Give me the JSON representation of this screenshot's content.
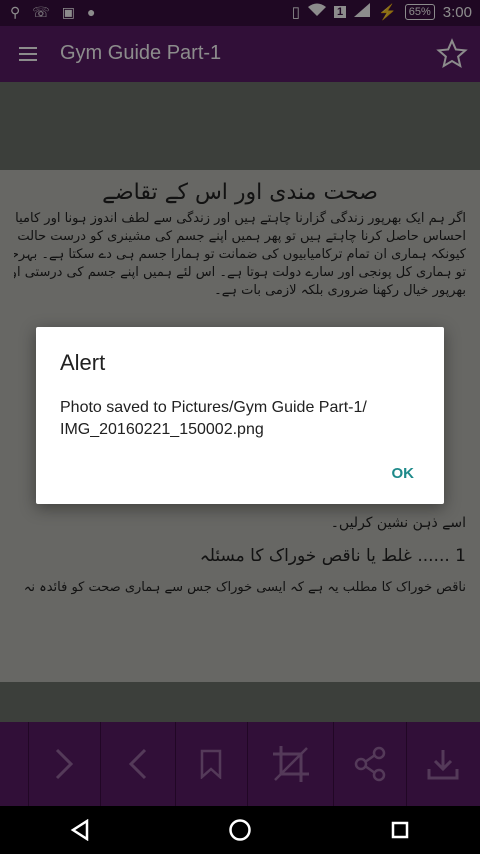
{
  "status_bar": {
    "battery": "65%",
    "time": "3:00",
    "sim": "1"
  },
  "toolbar": {
    "title": "Gym Guide Part-1",
    "menu_icon": "menu-icon",
    "star_icon": "star-outline-icon"
  },
  "page": {
    "heading": "صحت مندی اور اس کے تقاضے",
    "paragraph": [
      "اگر ہم ایک بھرپور زندگی گزارنا چاہتے ہیں اور زندگی سے لطف اندوز ہونا اور کامیابی کا",
      "احساس حاصل کرنا چاہتے ہیں تو پھر ہمیں اپنے جسم کی مشینری کو درست حالت میں رکھنا ہوگا۔",
      "کیونکہ ہماری ان تمام ترکامیابیوں کی ضمانت تو ہمارا جسم ہی دے سکتا ہے۔ بہرحال یہی",
      "تو ہماری کل پونجی اور سارے دولت ہوتا ہے۔ اس لئے ہمیں اپنے جسم کی درستی اور مرمت کا",
      "بھرپور خیال رکھنا ضروری بلکہ لازمی بات ہے۔"
    ],
    "line2": "اسے ذہن نشین کرلیں۔",
    "heading2": "1 ...... غلط یا ناقص خوراک کا مسئلہ",
    "line3": "ناقص خوراک کا مطلب یہ ہے کہ ایسی خوراک جس سے ہماری صحت کو فائدہ نہ"
  },
  "dialog": {
    "title": "Alert",
    "message": "Photo saved to Pictures/Gym Guide Part-1/ IMG_20160221_150002.png",
    "ok": "OK"
  },
  "bottom_bar": [
    "next-arrow-icon",
    "previous-arrow-icon",
    "bookmark-icon",
    "crop-icon",
    "share-icon",
    "download-icon"
  ],
  "colors": {
    "primary": "#5a1c66",
    "status_bar": "#3a0f40",
    "accent": "#1e8a8a"
  }
}
